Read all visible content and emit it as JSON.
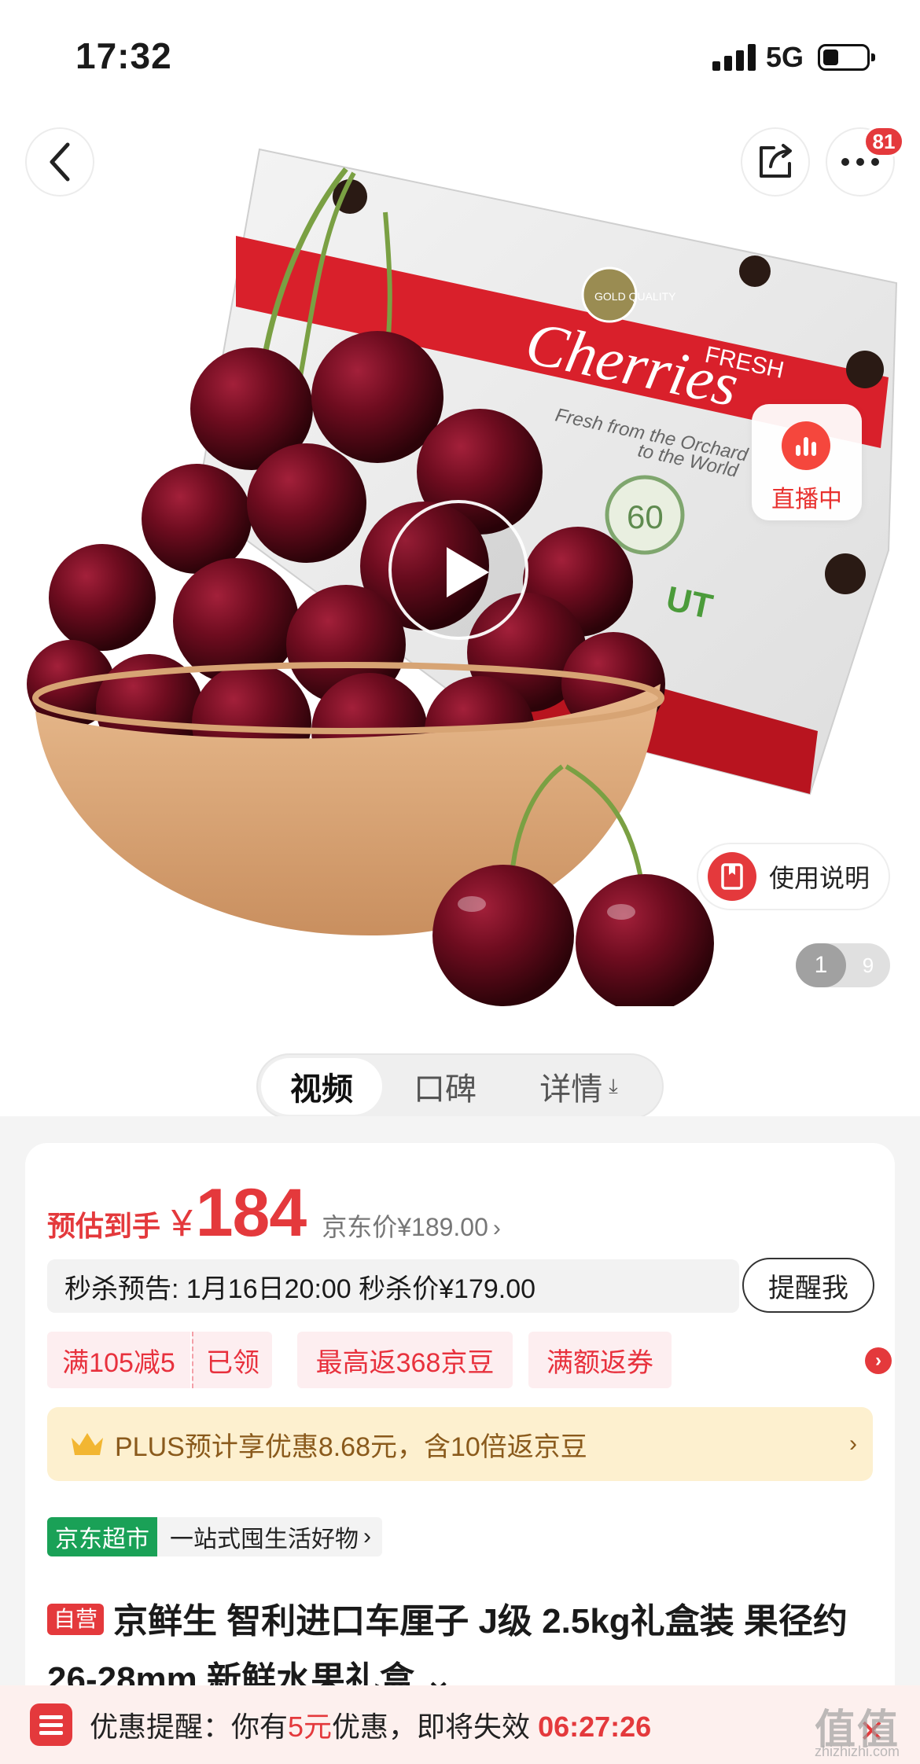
{
  "status_bar": {
    "time": "17:32",
    "network": "5G",
    "battery_level_fraction": 0.35
  },
  "nav": {
    "more_badge_count": "81"
  },
  "hero": {
    "live_label": "直播中",
    "manual_label": "使用说明",
    "pager_current": "1",
    "pager_total": "9",
    "product_box_text": {
      "quality_seal": "GOLD QUALITY",
      "fresh": "FRESH",
      "brand": "Cherries",
      "slogan_line1": "Fresh from the Orchard",
      "slogan_line2": "to the World",
      "anniversary": "60",
      "maker_partial": "UT"
    }
  },
  "tabs": [
    {
      "label": "视频",
      "active": true
    },
    {
      "label": "口碑",
      "active": false
    },
    {
      "label": "详情",
      "active": false,
      "icon": "download-arrow-icon"
    }
  ],
  "price": {
    "tag": "预估到手",
    "currency": "¥",
    "value": "184",
    "jd_price": "京东价¥189.00",
    "jd_arrow": "›"
  },
  "seckill": {
    "text": "秒杀预告: 1月16日20:00 秒杀价¥179.00",
    "remind_label": "提醒我"
  },
  "coupons": {
    "full_reduction": "满105减5",
    "claimed": "已领",
    "beans": "最高返368京豆",
    "return_coupon": "满额返券",
    "more_icon": "chevron-right-icon"
  },
  "plus": {
    "text": "PLUS预计享优惠8.68元，含10倍返京豆",
    "arrow": "›"
  },
  "shop": {
    "tag": "京东超市",
    "desc": "一站式囤生活好物",
    "arrow": "›"
  },
  "product": {
    "self_tag": "自营",
    "title": "京鲜生 智利进口车厘子 J级 2.5kg礼盒装 果径约26-28mm 新鲜水果礼盒",
    "expand": "⌄"
  },
  "reminder": {
    "prefix": "优惠提醒：你有",
    "amount": "5元",
    "suffix": "优惠，即将失效",
    "countdown": "06:27:26",
    "close": "✕"
  },
  "watermark": {
    "mark": "值值值",
    "site": "zhizhizhi.com"
  },
  "colors": {
    "brand_red": "#e4393c",
    "plus_gold": "#8a5a1c",
    "supermarket_green": "#1aa157"
  }
}
